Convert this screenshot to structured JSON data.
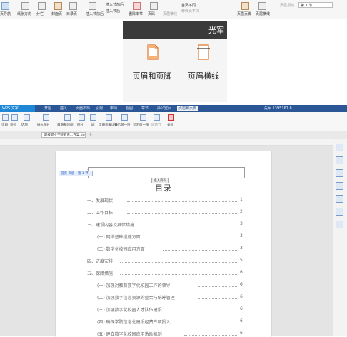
{
  "top_ribbon": {
    "items": [
      "页导航",
      "纸张方向",
      "分栏",
      "封面页",
      "目录页",
      "插入节前后",
      "插入节后",
      "删除本节",
      "页码",
      "页眉横线",
      "首页不同",
      "奇偶页不同",
      "页眉页脚",
      "页眉横线",
      "页眉顶端",
      "第 1 节"
    ],
    "section_label": "第 1 节"
  },
  "zoom_panel": {
    "title_fragment": "光军",
    "btn1_label": "页眉和页脚",
    "btn2_label": "页眉横线"
  },
  "wps": {
    "app_name": "WPS 文字",
    "menu": [
      "开始",
      "插入",
      "页面布局",
      "引用",
      "审阅",
      "视图",
      "章节",
      "办公空间",
      "页眉和页脚"
    ],
    "user_info": "先军 1395167 6...",
    "toolbar": [
      "页眉",
      "页码",
      "选项",
      "插入图片",
      "日期和时间",
      "图片",
      "域",
      "页眉页脚切换",
      "显示前一项",
      "显示后一项",
      "同前节",
      "关闭"
    ],
    "doc_tab": "职校职业学院教育...方案.doc *",
    "header_label": "首页 页眉 - 第 1 节 -",
    "insert_page_num": "插入页码",
    "toc_title": "目录",
    "toc": [
      {
        "text": "一、发展现状",
        "page": "1"
      },
      {
        "text": "二、工作目标",
        "page": "2"
      },
      {
        "text": "三、建设内容及具体措施",
        "page": "3"
      },
      {
        "text": "(一) 网络基础设施方面",
        "page": "3"
      },
      {
        "text": "(二) 数字化校园应用方面",
        "page": "3"
      },
      {
        "text": "四、进度安排",
        "page": "5"
      },
      {
        "text": "五、保障措施",
        "page": "6"
      },
      {
        "text": "(一)  加强对教育数字化校园工作的领导",
        "page": "6"
      },
      {
        "text": "(二) 加强数字信息资源的整合与统筹管理",
        "page": "6"
      },
      {
        "text": "(三) 加强数字化校园人才队伍建设",
        "page": "6"
      },
      {
        "text": "(四) 确保学院信息化建设经费专项投入",
        "page": "6"
      },
      {
        "text": "(五)  建立数字化校园应用激励机制",
        "page": "6"
      }
    ]
  },
  "colors": {
    "menubar": "#2b5797",
    "accent": "#1e88d6",
    "zoom_titlebar": "#3a3a3a",
    "icon_orange": "#e0782c"
  }
}
